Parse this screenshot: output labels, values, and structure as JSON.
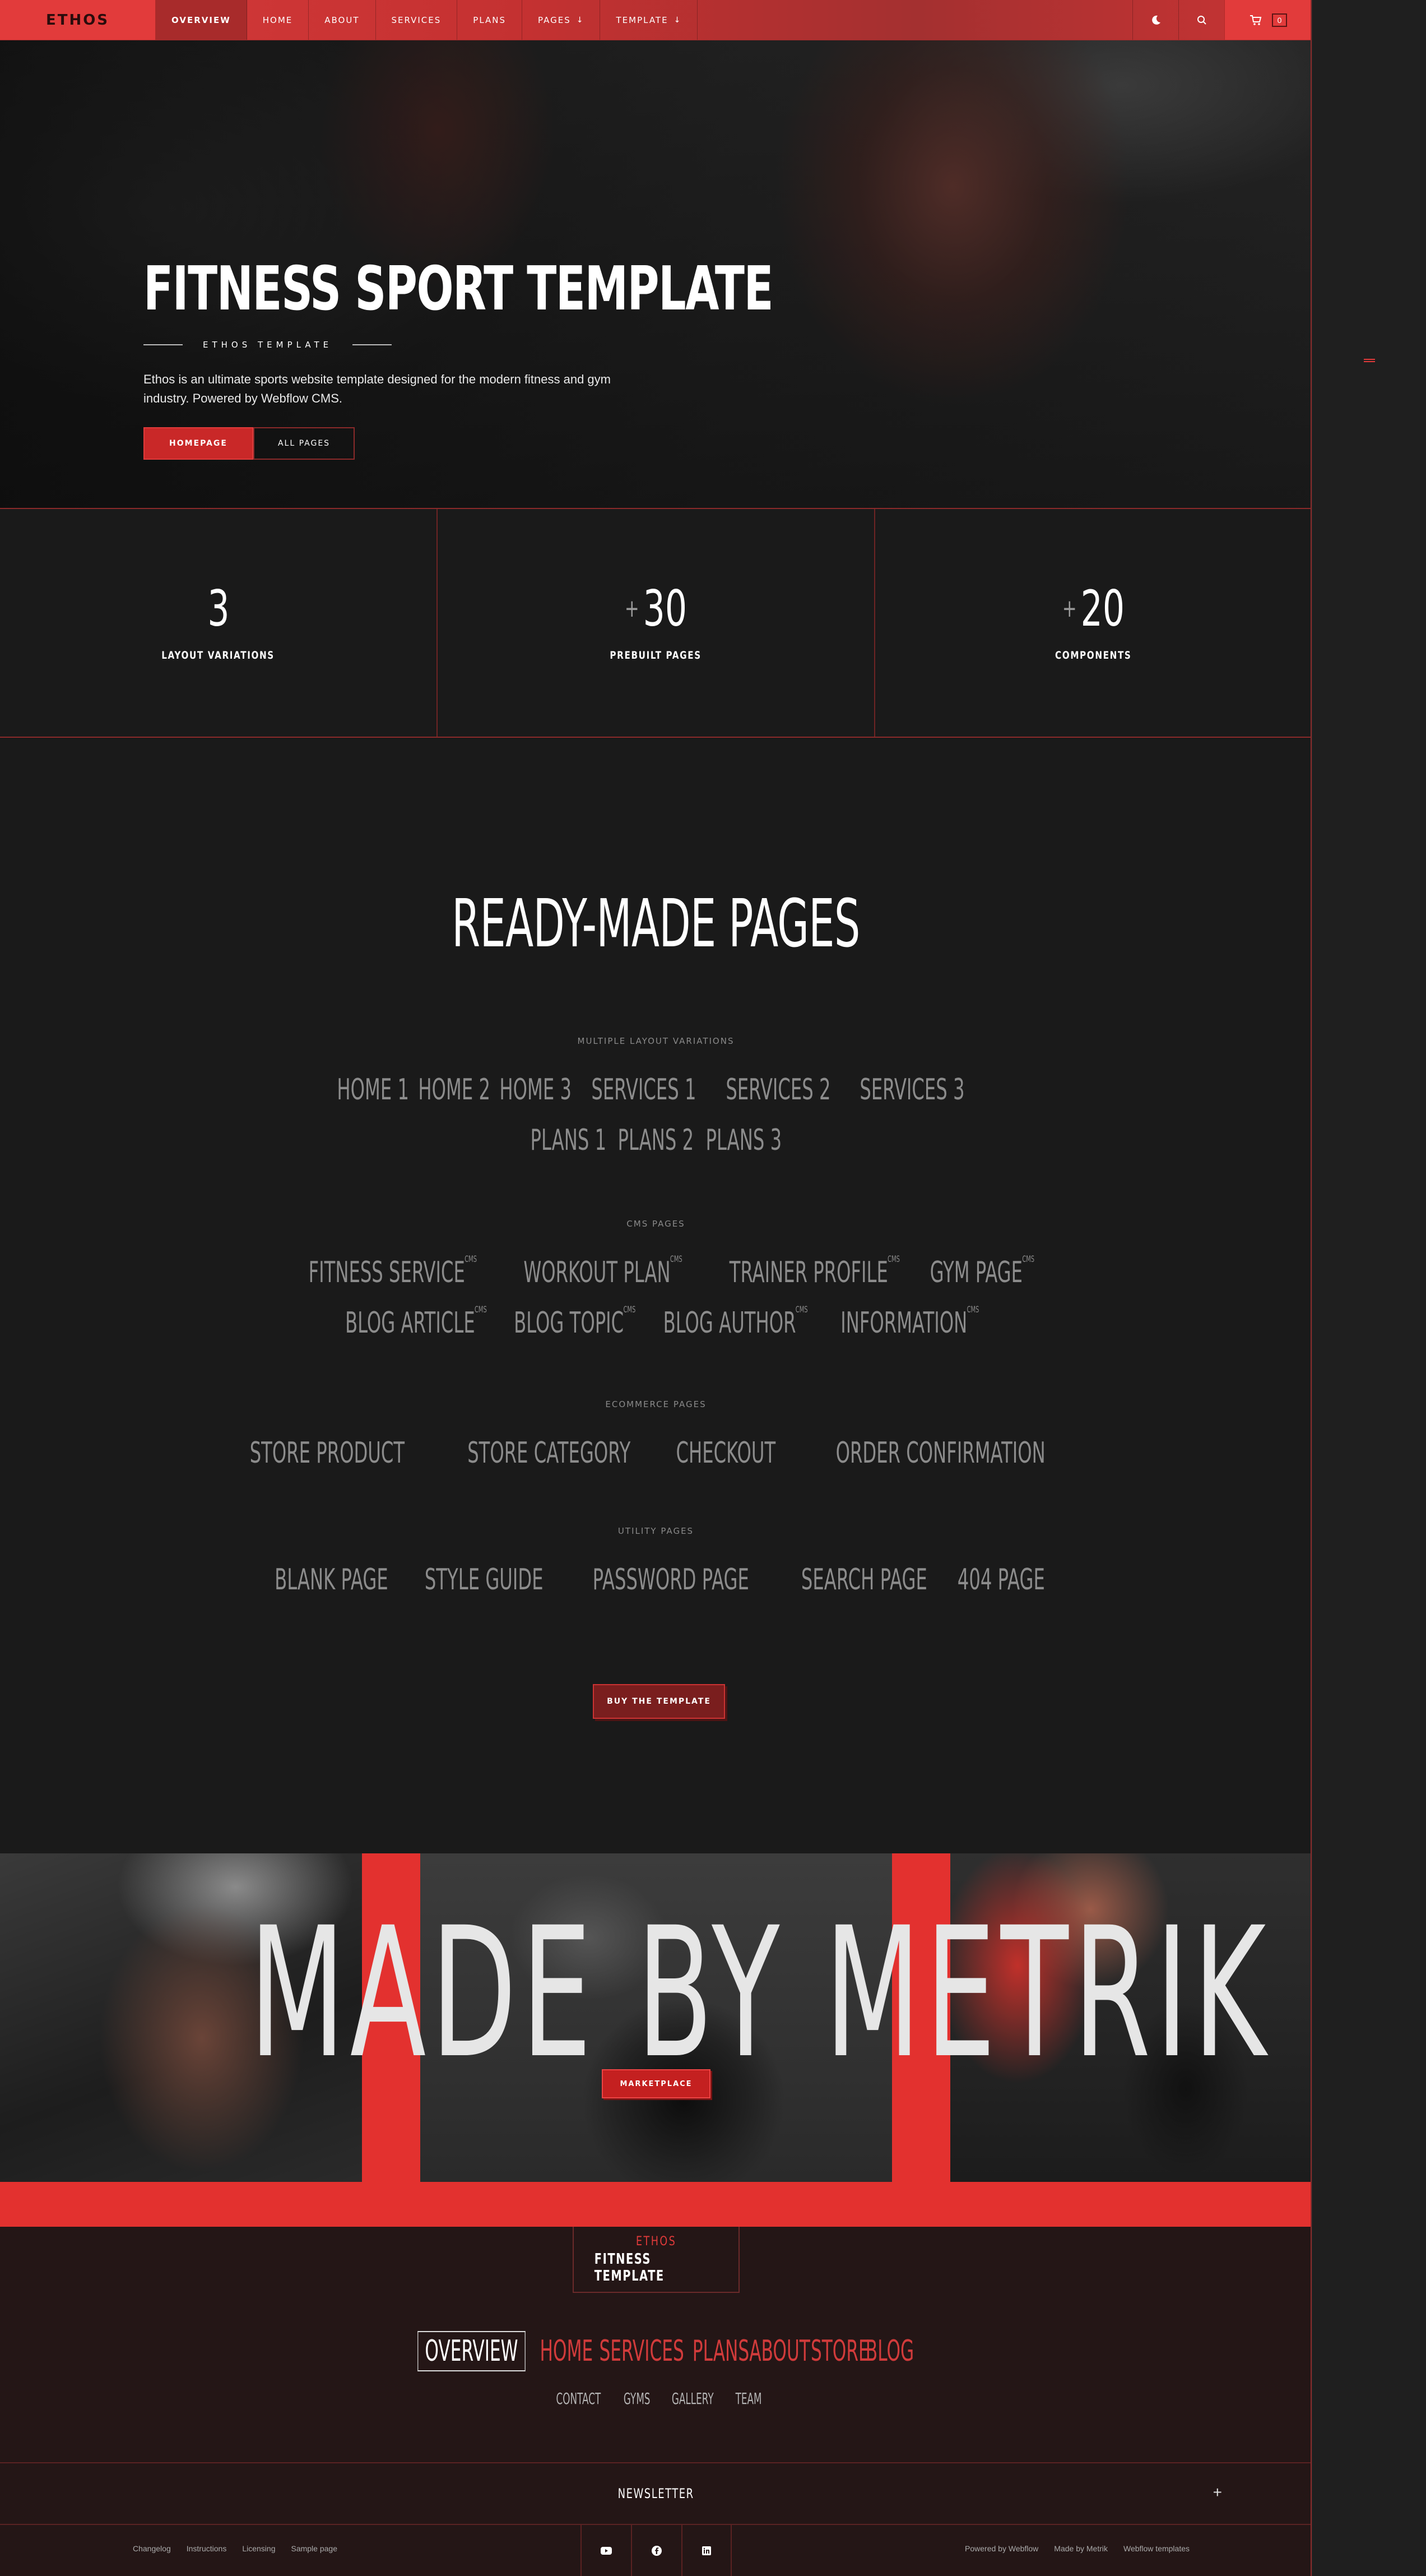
{
  "nav": {
    "logo": "ETHOS",
    "items": [
      {
        "label": "OVERVIEW"
      },
      {
        "label": "HOME"
      },
      {
        "label": "ABOUT"
      },
      {
        "label": "SERVICES"
      },
      {
        "label": "PLANS"
      },
      {
        "label": "PAGES"
      },
      {
        "label": "TEMPLATE"
      }
    ],
    "cart_count": "0"
  },
  "hero": {
    "title": "FITNESS SPORT TEMPLATE",
    "subtitle": "ETHOS TEMPLATE",
    "description": "Ethos is an ultimate sports website template designed for the modern fitness and gym industry. Powered by Webflow CMS.",
    "btn_primary": "HOMEPAGE",
    "btn_secondary": "ALL PAGES"
  },
  "stats": [
    {
      "prefix": "",
      "value": "3",
      "label": "LAYOUT VARIATIONS"
    },
    {
      "prefix": "+",
      "value": "30",
      "label": "PREBUILT PAGES"
    },
    {
      "prefix": "+",
      "value": "20",
      "label": "COMPONENTS"
    }
  ],
  "pages": {
    "title": "READY-MADE PAGES",
    "groups": [
      {
        "title": "MULTIPLE LAYOUT VARIATIONS",
        "rows": [
          [
            "HOME 1",
            "HOME 2",
            "HOME 3",
            "SERVICES 1",
            "SERVICES 2",
            "SERVICES 3"
          ],
          [
            "PLANS 1",
            "PLANS 2",
            "PLANS 3"
          ]
        ]
      },
      {
        "title": "CMS PAGES",
        "rows": [
          [
            "FITNESS SERVICE",
            "WORKOUT PLAN",
            "TRAINER PROFILE",
            "GYM PAGE"
          ],
          [
            "BLOG ARTICLE",
            "BLOG TOPIC",
            "BLOG AUTHOR",
            "INFORMATION"
          ]
        ],
        "badge": "CMS"
      },
      {
        "title": "ECOMMERCE PAGES",
        "rows": [
          [
            "STORE PRODUCT",
            "STORE CATEGORY",
            "CHECKOUT",
            "ORDER CONFIRMATION"
          ]
        ]
      },
      {
        "title": "UTILITY PAGES",
        "rows": [
          [
            "BLANK PAGE",
            "STYLE GUIDE",
            "PASSWORD PAGE",
            "SEARCH PAGE",
            "404 PAGE"
          ]
        ]
      }
    ],
    "buy_label": "BUY THE TEMPLATE"
  },
  "metrik": {
    "headline": "MADE BY METRIK",
    "button": "MARKETPLACE"
  },
  "footer": {
    "brand_top": "ETHOS",
    "brand_bottom": "FITNESS TEMPLATE",
    "nav": [
      "OVERVIEW",
      "HOME",
      "SERVICES",
      "PLANS",
      "ABOUT",
      "STORE",
      "BLOG"
    ],
    "subnav": [
      "CONTACT",
      "GYMS",
      "GALLERY",
      "TEAM"
    ],
    "newsletter": "NEWSLETTER",
    "bottom_left": [
      "Changelog",
      "Instructions",
      "Licensing",
      "Sample page"
    ],
    "bottom_right": [
      "Powered by Webflow",
      "Made by Metrik",
      "Webflow templates"
    ]
  },
  "colors": {
    "accent": "#e23b3b",
    "dark": "#1a1a1a",
    "footer_bg": "#241616"
  }
}
